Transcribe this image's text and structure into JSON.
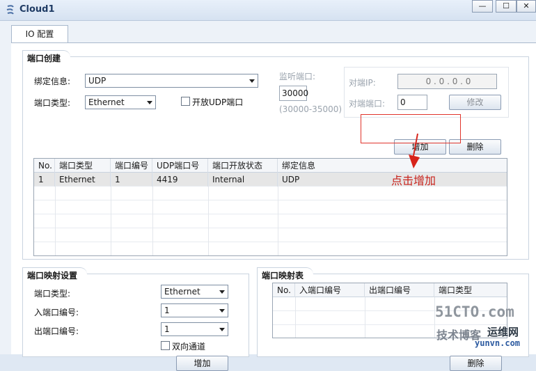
{
  "window": {
    "title": "Cloud1",
    "min_label": "—",
    "max_label": "☐",
    "close_label": "✕"
  },
  "tabs": [
    {
      "label": "IO 配置"
    }
  ],
  "port_create": {
    "title": "端口创建",
    "bind_label": "绑定信息:",
    "bind_value": "UDP",
    "port_type_label": "端口类型:",
    "port_type_value": "Ethernet",
    "open_udp_label": "开放UDP端口",
    "listen_port_label": "监听端口:",
    "listen_port_value": "30000",
    "listen_port_range": "(30000-35000)",
    "peer_ip_label": "对端IP:",
    "peer_ip_value": "0 . 0 . 0 . 0",
    "peer_port_label": "对端端口:",
    "peer_port_value": "0",
    "modify_button": "修改",
    "add_button": "增加",
    "delete_button": "删除"
  },
  "port_table": {
    "headers": [
      "No.",
      "端口类型",
      "端口编号",
      "UDP端口号",
      "端口开放状态",
      "绑定信息"
    ],
    "rows": [
      [
        "1",
        "Ethernet",
        "1",
        "4419",
        "Internal",
        "UDP"
      ]
    ]
  },
  "annotation": {
    "text": "点击增加",
    "color": "#c8221b"
  },
  "port_map_settings": {
    "title": "端口映射设置",
    "port_type_label": "端口类型:",
    "port_type_value": "Ethernet",
    "in_port_label": "入端口编号:",
    "in_port_value": "1",
    "out_port_label": "出端口编号:",
    "out_port_value": "1",
    "bidirectional_label": "双向通道",
    "add_button": "增加"
  },
  "port_map_table": {
    "title": "端口映射表",
    "headers": [
      "No.",
      "入端口编号",
      "出端口编号",
      "端口类型"
    ],
    "delete_button": "删除"
  },
  "watermark": {
    "line1": "51CTO.com",
    "line2": "技术博客",
    "line3": "运维网",
    "line4": "yunvn.com"
  }
}
